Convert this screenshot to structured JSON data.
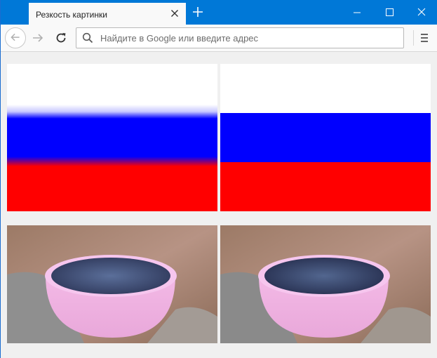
{
  "browser": {
    "tab_title": "Резкость картинки",
    "address_placeholder": "Найдите в Google или введите адрес",
    "accent_color": "#0078d7"
  },
  "content": {
    "images": [
      {
        "name": "russian-flag-blurred",
        "colors": [
          "#ffffff",
          "#0000ff",
          "#ff0000"
        ]
      },
      {
        "name": "russian-flag-sharp",
        "colors": [
          "#ffffff",
          "#0000ff",
          "#ff0000"
        ]
      },
      {
        "name": "blueberries-bowl-photo"
      },
      {
        "name": "blueberries-bowl-photo-sharpened"
      }
    ]
  }
}
